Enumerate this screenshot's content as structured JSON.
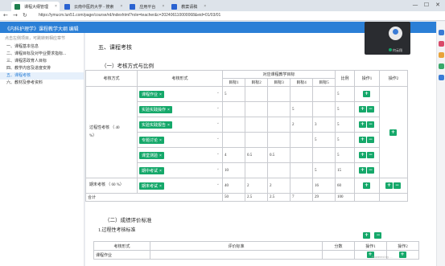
{
  "browser": {
    "tabs": [
      {
        "label": "课程大纲管理",
        "color": "#1e7f4e"
      },
      {
        "label": "云南中医药大学 - 搜索",
        "color": "#2b63d1"
      },
      {
        "label": "应用平台",
        "color": "#2b63d1"
      },
      {
        "label": "教案请稿",
        "color": "#2b63d1"
      }
    ],
    "url": "https://ymucm.lun51.com/page/course/rd/indexhtml?role=teacher&c=202406110000068&eid=01/03/01"
  },
  "app": {
    "title": "《内科护理学》课程教学大纲 编辑"
  },
  "sidebar": {
    "hint": "点击左侧项目，可跳转到相应章节",
    "items": [
      {
        "label": "一、课程基本信息"
      },
      {
        "label": "二、课程目标及对毕业要求指标..."
      },
      {
        "label": "三、课程思政育人目标"
      },
      {
        "label": "四、教学内容及进度安排"
      },
      {
        "label": "五、课程考核"
      },
      {
        "label": "六、教材及参考资料"
      }
    ]
  },
  "main": {
    "section_title": "五、课程考核",
    "sub_title": "（一）考核方式与比例",
    "table": {
      "h_method": "考核方式",
      "h_form": "考核形式",
      "h_goal_group": "对应课程教学目标",
      "goals": [
        "目标1",
        "目标2",
        "目标3",
        "目标4",
        "目标5"
      ],
      "h_ratio": "比例",
      "h_op1": "操作1",
      "h_op2": "操作2",
      "process_label": "过程性考核",
      "process_pct": "（ 40 %）",
      "final_label": "期末考核",
      "final_pct": "（ 60 %）",
      "rows": [
        {
          "tag": "课程作业",
          "g": [
            "5",
            "",
            "",
            "",
            ""
          ],
          "ratio": "5"
        },
        {
          "tag": "实验实践操作",
          "g": [
            "",
            "",
            "",
            "5",
            ""
          ],
          "ratio": "5"
        },
        {
          "tag": "实验实践报告",
          "g": [
            "",
            "",
            "",
            "2",
            "3"
          ],
          "ratio": "5"
        },
        {
          "tag": "专题讨论",
          "g": [
            "",
            "",
            "",
            "",
            "5"
          ],
          "ratio": "5"
        },
        {
          "tag": "课堂测验",
          "g": [
            "4",
            "0.5",
            "0.5",
            "",
            ""
          ],
          "ratio": "5"
        },
        {
          "tag": "期中考试",
          "g": [
            "10",
            "",
            "",
            "",
            "5"
          ],
          "ratio": "15"
        },
        {
          "tag": "期末考试",
          "g": [
            "40",
            "2",
            "2",
            "",
            "16"
          ],
          "ratio": "60"
        }
      ],
      "total_label": "合计",
      "total": [
        "50",
        "2.5",
        "2.5",
        "7",
        "29"
      ],
      "total_ratio": "100"
    },
    "sub_title2": "（二）成绩评价标准",
    "sub_title3": "1.过程性考核标准",
    "table2": {
      "h_form": "考核形式",
      "h_standard": "评价标准",
      "h_score": "分数",
      "h_op1": "操作1",
      "h_op2": "操作2",
      "row1_label": "课程作业"
    }
  },
  "buttons": {
    "plus": "+",
    "minus": "−",
    "remove": "×",
    "caret": "⌄"
  },
  "video": {
    "name": "何云翔"
  },
  "watermark": "Powered by ...",
  "window": {
    "minimize": "—",
    "maximize": "☐",
    "close": "✕"
  }
}
